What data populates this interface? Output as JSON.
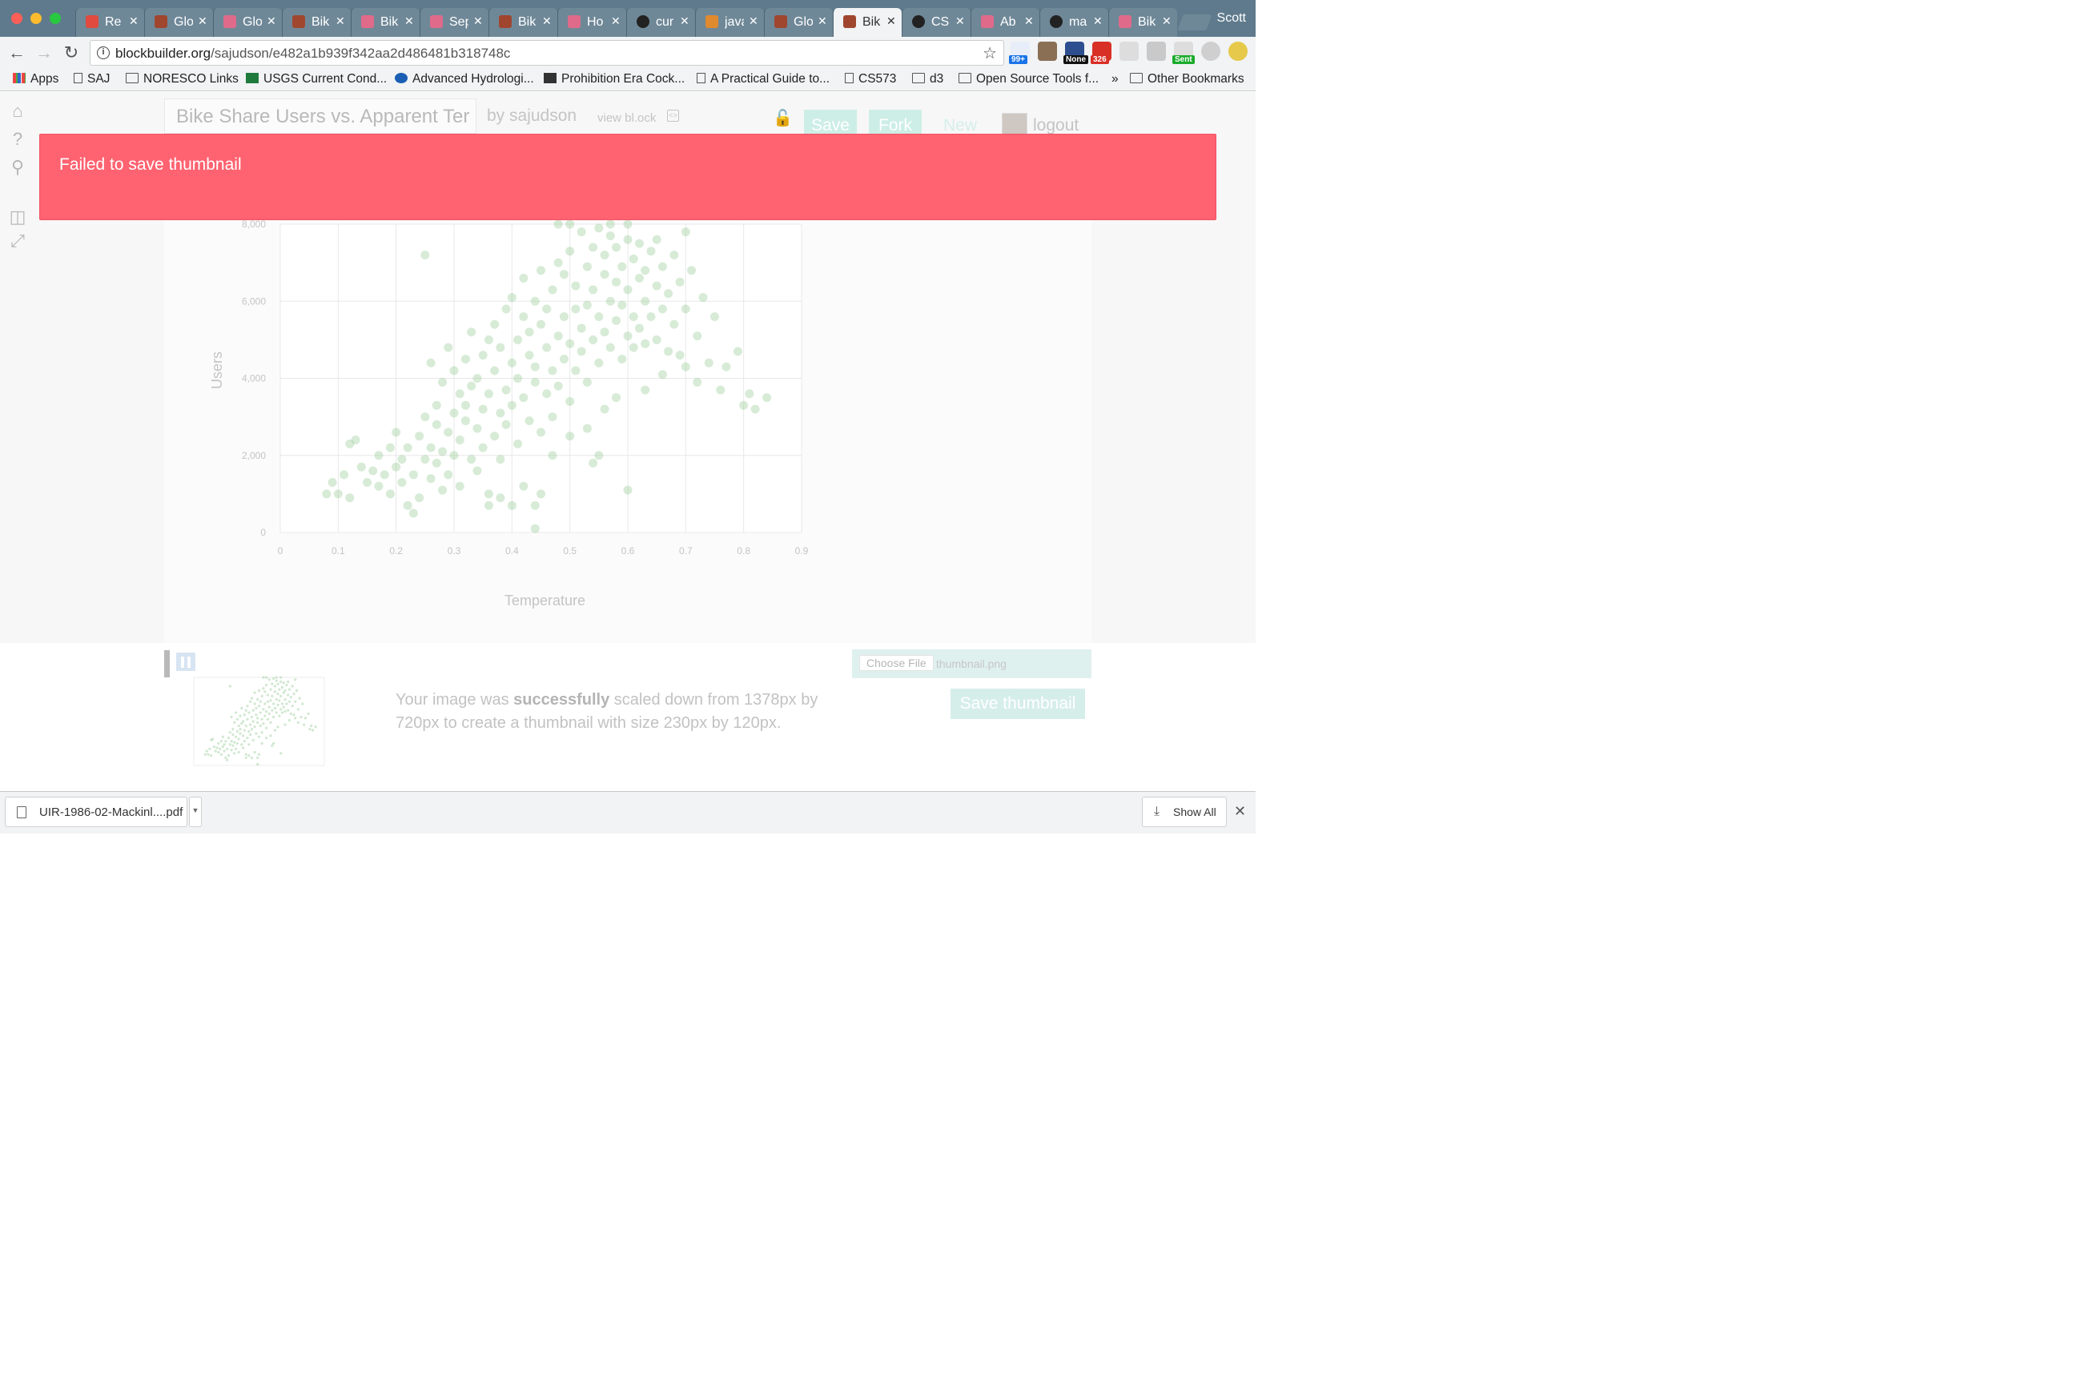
{
  "browser": {
    "profile": "Scott",
    "tabs": [
      {
        "title": "Re",
        "icon": "redux-logo-icon",
        "color": "#e04a3f",
        "active": false
      },
      {
        "title": "Glo",
        "icon": "brick-icon",
        "color": "#a0462f",
        "active": false
      },
      {
        "title": "Glo",
        "icon": "cubes-icon",
        "color": "#e06a8a",
        "active": false
      },
      {
        "title": "Bik",
        "icon": "brick-icon",
        "color": "#a0462f",
        "active": false
      },
      {
        "title": "Bik",
        "icon": "cubes-icon",
        "color": "#e06a8a",
        "active": false
      },
      {
        "title": "Sep",
        "icon": "cubes-icon",
        "color": "#e06a8a",
        "active": false
      },
      {
        "title": "Bik",
        "icon": "brick-icon",
        "color": "#a0462f",
        "active": false
      },
      {
        "title": "Ho",
        "icon": "cubes-icon",
        "color": "#e06a8a",
        "active": false
      },
      {
        "title": "cur",
        "icon": "github-icon",
        "color": "#222222",
        "active": false
      },
      {
        "title": "java",
        "icon": "stackoverflow-icon",
        "color": "#e08a2f",
        "active": false
      },
      {
        "title": "Glo",
        "icon": "brick-icon",
        "color": "#a0462f",
        "active": false
      },
      {
        "title": "Bik",
        "icon": "brick-icon",
        "color": "#a0462f",
        "active": true
      },
      {
        "title": "CS",
        "icon": "github-icon",
        "color": "#222222",
        "active": false
      },
      {
        "title": "Ab",
        "icon": "cubes-icon",
        "color": "#e06a8a",
        "active": false
      },
      {
        "title": "ma",
        "icon": "github-icon",
        "color": "#222222",
        "active": false
      },
      {
        "title": "Bik",
        "icon": "cubes-icon",
        "color": "#e06a8a",
        "active": false
      }
    ],
    "url_host": "blockbuilder.org",
    "url_path": "/sajudson/e482a1b939f342aa2d486481b318748c",
    "extensions": [
      {
        "name": "gmail-counter-icon",
        "badge": "99+",
        "badge_color": "#1a73e8"
      },
      {
        "name": "toolbox-icon",
        "badge": "",
        "badge_color": ""
      },
      {
        "name": "none-extension-icon",
        "badge": "None",
        "badge_color": "#111111"
      },
      {
        "name": "gmail-icon",
        "badge": "326",
        "badge_color": "#d93025"
      },
      {
        "name": "info-extension-icon",
        "badge": "",
        "badge_color": ""
      },
      {
        "name": "drive-icon",
        "badge": "",
        "badge_color": ""
      },
      {
        "name": "sent-tracker-icon",
        "badge": "Sent",
        "badge_color": "#1aab2c"
      },
      {
        "name": "skype-icon",
        "badge": "",
        "badge_color": ""
      },
      {
        "name": "bulb-icon",
        "badge": "",
        "badge_color": ""
      }
    ],
    "bookmarks": [
      {
        "label": "Apps",
        "icon": "apps-icon"
      },
      {
        "label": "SAJ",
        "icon": "page-icon"
      },
      {
        "label": "NORESCO Links",
        "icon": "folder-icon"
      },
      {
        "label": "USGS Current Cond...",
        "icon": "usgs-icon"
      },
      {
        "label": "Advanced Hydrologi...",
        "icon": "noaa-icon"
      },
      {
        "label": "Prohibition Era Cock...",
        "icon": "prohibition-icon"
      },
      {
        "label": "A Practical Guide to...",
        "icon": "page-icon"
      },
      {
        "label": "CS573",
        "icon": "page-icon"
      },
      {
        "label": "d3",
        "icon": "folder-icon"
      },
      {
        "label": "Open Source Tools f...",
        "icon": "folder-icon"
      },
      {
        "label": "»",
        "icon": ""
      },
      {
        "label": "Other Bookmarks",
        "icon": "folder-icon"
      }
    ]
  },
  "editor": {
    "title": "Bike Share Users vs. Apparent Ter",
    "author": "by sajudson",
    "view_block": "view bl.ock",
    "save": "Save",
    "fork": "Fork",
    "new": "New",
    "logout": "logout"
  },
  "error_banner": {
    "message": "Failed to save thumbnail",
    "color": "#ff6270"
  },
  "chart_data": {
    "type": "scatter",
    "title": "",
    "xlabel": "Temperature",
    "ylabel": "Users",
    "xlim": [
      0,
      0.9
    ],
    "ylim": [
      0,
      8000
    ],
    "x_ticks": [
      "0",
      "0.1",
      "0.2",
      "0.3",
      "0.4",
      "0.5",
      "0.6",
      "0.7",
      "0.8",
      "0.9"
    ],
    "y_ticks": [
      "0",
      "2,000",
      "4,000",
      "6,000",
      "8,000"
    ],
    "grid": true,
    "point_color": "#8cc68c",
    "points": [
      [
        0.08,
        1000
      ],
      [
        0.1,
        1000
      ],
      [
        0.09,
        1300
      ],
      [
        0.12,
        900
      ],
      [
        0.11,
        1500
      ],
      [
        0.12,
        2300
      ],
      [
        0.13,
        2400
      ],
      [
        0.14,
        1700
      ],
      [
        0.15,
        1300
      ],
      [
        0.16,
        1600
      ],
      [
        0.17,
        2000
      ],
      [
        0.17,
        1200
      ],
      [
        0.18,
        1500
      ],
      [
        0.19,
        2200
      ],
      [
        0.19,
        1000
      ],
      [
        0.2,
        1700
      ],
      [
        0.2,
        2600
      ],
      [
        0.21,
        1300
      ],
      [
        0.21,
        1900
      ],
      [
        0.22,
        700
      ],
      [
        0.22,
        2200
      ],
      [
        0.23,
        500
      ],
      [
        0.23,
        1500
      ],
      [
        0.24,
        2500
      ],
      [
        0.24,
        900
      ],
      [
        0.25,
        1900
      ],
      [
        0.25,
        3000
      ],
      [
        0.25,
        7200
      ],
      [
        0.26,
        1400
      ],
      [
        0.26,
        2200
      ],
      [
        0.26,
        4400
      ],
      [
        0.27,
        1800
      ],
      [
        0.27,
        2800
      ],
      [
        0.27,
        3300
      ],
      [
        0.28,
        2100
      ],
      [
        0.28,
        1100
      ],
      [
        0.28,
        3900
      ],
      [
        0.29,
        2600
      ],
      [
        0.29,
        1500
      ],
      [
        0.29,
        4800
      ],
      [
        0.3,
        3100
      ],
      [
        0.3,
        2000
      ],
      [
        0.3,
        4200
      ],
      [
        0.31,
        3600
      ],
      [
        0.31,
        1200
      ],
      [
        0.31,
        2400
      ],
      [
        0.32,
        4500
      ],
      [
        0.32,
        2900
      ],
      [
        0.32,
        3300
      ],
      [
        0.33,
        1900
      ],
      [
        0.33,
        3800
      ],
      [
        0.33,
        5200
      ],
      [
        0.34,
        2700
      ],
      [
        0.34,
        4000
      ],
      [
        0.34,
        1600
      ],
      [
        0.35,
        3200
      ],
      [
        0.35,
        4600
      ],
      [
        0.35,
        2200
      ],
      [
        0.36,
        5000
      ],
      [
        0.36,
        3600
      ],
      [
        0.36,
        1000
      ],
      [
        0.37,
        2500
      ],
      [
        0.37,
        4200
      ],
      [
        0.37,
        5400
      ],
      [
        0.38,
        3100
      ],
      [
        0.38,
        4800
      ],
      [
        0.38,
        1900
      ],
      [
        0.39,
        3700
      ],
      [
        0.39,
        5800
      ],
      [
        0.39,
        2800
      ],
      [
        0.4,
        4400
      ],
      [
        0.4,
        3300
      ],
      [
        0.4,
        6100
      ],
      [
        0.41,
        2300
      ],
      [
        0.41,
        5000
      ],
      [
        0.41,
        4000
      ],
      [
        0.42,
        3500
      ],
      [
        0.42,
        5600
      ],
      [
        0.42,
        6600
      ],
      [
        0.43,
        4600
      ],
      [
        0.43,
        2900
      ],
      [
        0.43,
        5200
      ],
      [
        0.44,
        3900
      ],
      [
        0.44,
        6000
      ],
      [
        0.44,
        4300
      ],
      [
        0.45,
        5400
      ],
      [
        0.45,
        2600
      ],
      [
        0.45,
        6800
      ],
      [
        0.46,
        4800
      ],
      [
        0.46,
        3600
      ],
      [
        0.46,
        5800
      ],
      [
        0.47,
        4200
      ],
      [
        0.47,
        6300
      ],
      [
        0.47,
        3000
      ],
      [
        0.48,
        5100
      ],
      [
        0.48,
        7000
      ],
      [
        0.48,
        3800
      ],
      [
        0.49,
        5600
      ],
      [
        0.49,
        4500
      ],
      [
        0.49,
        6700
      ],
      [
        0.5,
        4900
      ],
      [
        0.5,
        7300
      ],
      [
        0.5,
        3400
      ],
      [
        0.51,
        5800
      ],
      [
        0.51,
        6400
      ],
      [
        0.51,
        4200
      ],
      [
        0.52,
        7800
      ],
      [
        0.52,
        5300
      ],
      [
        0.52,
        4700
      ],
      [
        0.53,
        6900
      ],
      [
        0.53,
        5900
      ],
      [
        0.53,
        3900
      ],
      [
        0.54,
        7400
      ],
      [
        0.54,
        5000
      ],
      [
        0.54,
        6300
      ],
      [
        0.55,
        7900
      ],
      [
        0.55,
        5600
      ],
      [
        0.55,
        4400
      ],
      [
        0.56,
        6700
      ],
      [
        0.56,
        7200
      ],
      [
        0.56,
        5200
      ],
      [
        0.57,
        6000
      ],
      [
        0.57,
        7700
      ],
      [
        0.57,
        4800
      ],
      [
        0.58,
        6500
      ],
      [
        0.58,
        5500
      ],
      [
        0.58,
        7400
      ],
      [
        0.59,
        4500
      ],
      [
        0.59,
        6900
      ],
      [
        0.59,
        5900
      ],
      [
        0.6,
        7600
      ],
      [
        0.6,
        5100
      ],
      [
        0.6,
        6300
      ],
      [
        0.61,
        5600
      ],
      [
        0.61,
        7100
      ],
      [
        0.61,
        4800
      ],
      [
        0.62,
        6600
      ],
      [
        0.62,
        5300
      ],
      [
        0.62,
        7500
      ],
      [
        0.63,
        6000
      ],
      [
        0.63,
        4900
      ],
      [
        0.63,
        6800
      ],
      [
        0.64,
        7300
      ],
      [
        0.64,
        5600
      ],
      [
        0.65,
        6400
      ],
      [
        0.65,
        5000
      ],
      [
        0.65,
        7600
      ],
      [
        0.66,
        5800
      ],
      [
        0.66,
        6900
      ],
      [
        0.67,
        4700
      ],
      [
        0.67,
        6200
      ],
      [
        0.68,
        5400
      ],
      [
        0.68,
        7200
      ],
      [
        0.69,
        4600
      ],
      [
        0.69,
        6500
      ],
      [
        0.7,
        5800
      ],
      [
        0.7,
        4300
      ],
      [
        0.71,
        6800
      ],
      [
        0.72,
        5100
      ],
      [
        0.72,
        3900
      ],
      [
        0.73,
        6100
      ],
      [
        0.74,
        4400
      ],
      [
        0.75,
        5600
      ],
      [
        0.76,
        3700
      ],
      [
        0.77,
        4300
      ],
      [
        0.79,
        4700
      ],
      [
        0.8,
        3300
      ],
      [
        0.81,
        3600
      ],
      [
        0.82,
        3200
      ],
      [
        0.84,
        3500
      ],
      [
        0.6,
        1100
      ],
      [
        0.55,
        2000
      ],
      [
        0.54,
        1800
      ],
      [
        0.45,
        1000
      ],
      [
        0.44,
        700
      ],
      [
        0.4,
        700
      ],
      [
        0.42,
        1200
      ],
      [
        0.38,
        900
      ],
      [
        0.36,
        700
      ],
      [
        0.53,
        2700
      ],
      [
        0.5,
        2500
      ],
      [
        0.47,
        2000
      ],
      [
        0.63,
        3700
      ],
      [
        0.66,
        4100
      ],
      [
        0.58,
        3500
      ],
      [
        0.56,
        3200
      ],
      [
        0.44,
        100
      ],
      [
        0.5,
        8000
      ],
      [
        0.48,
        8000
      ],
      [
        0.6,
        8000
      ],
      [
        0.57,
        8000
      ],
      [
        0.7,
        7800
      ]
    ]
  },
  "thumbnail": {
    "choose_file": "Choose File",
    "file_name": "thumbnail.png",
    "message_pre": "Your image was ",
    "message_bold": "successfully",
    "message_post": " scaled down from 1378px by 720px to create a thumbnail with size 230px by 120px.",
    "save_button": "Save thumbnail"
  },
  "downloads": {
    "file_name": "UIR-1986-02-Mackinl....pdf",
    "show_all": "Show All"
  }
}
